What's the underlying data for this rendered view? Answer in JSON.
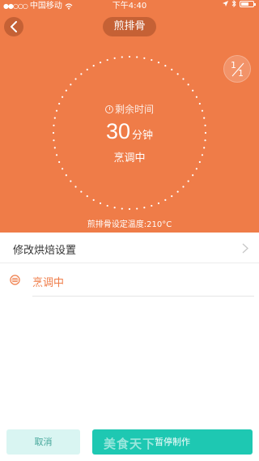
{
  "status_bar": {
    "carrier": "中国移动",
    "time": "下午4:40"
  },
  "header": {
    "title": "煎排骨",
    "page_current": "1",
    "page_total": "1"
  },
  "timer": {
    "remaining_label": "剩余时间",
    "value": "30",
    "unit": "分钟",
    "state": "烹调中"
  },
  "temperature_line": "煎排骨设定温度:210°C",
  "settings": {
    "label": "修改烘焙设置"
  },
  "status": {
    "text": "烹调中"
  },
  "buttons": {
    "cancel": "取消",
    "pause": "暂停制作"
  },
  "watermark": "美食天下",
  "colors": {
    "accent": "#ef7c48",
    "primary_button": "#1ec8b2",
    "secondary_button": "#d9f5f2"
  }
}
